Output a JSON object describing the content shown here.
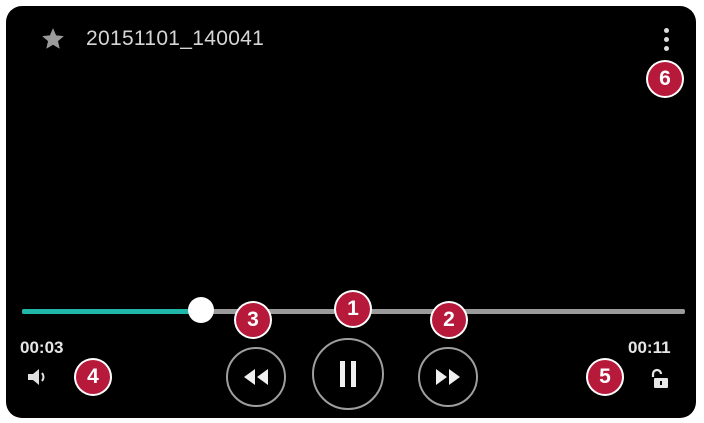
{
  "player": {
    "title": "20151101_140041",
    "time_current": "00:03",
    "time_total": "00:11",
    "progress_fraction": 0.27
  },
  "icons": {
    "favorite": "star-icon",
    "more": "more-vert-icon",
    "volume": "volume-icon",
    "rewind": "rewind-icon",
    "pause": "pause-icon",
    "forward": "fast-forward-icon",
    "lock": "unlock-icon"
  },
  "callouts": [
    "1",
    "2",
    "3",
    "4",
    "5",
    "6"
  ],
  "colors": {
    "accent": "#20b7a8",
    "callout": "#b7193a",
    "track": "#9a9a9a"
  }
}
